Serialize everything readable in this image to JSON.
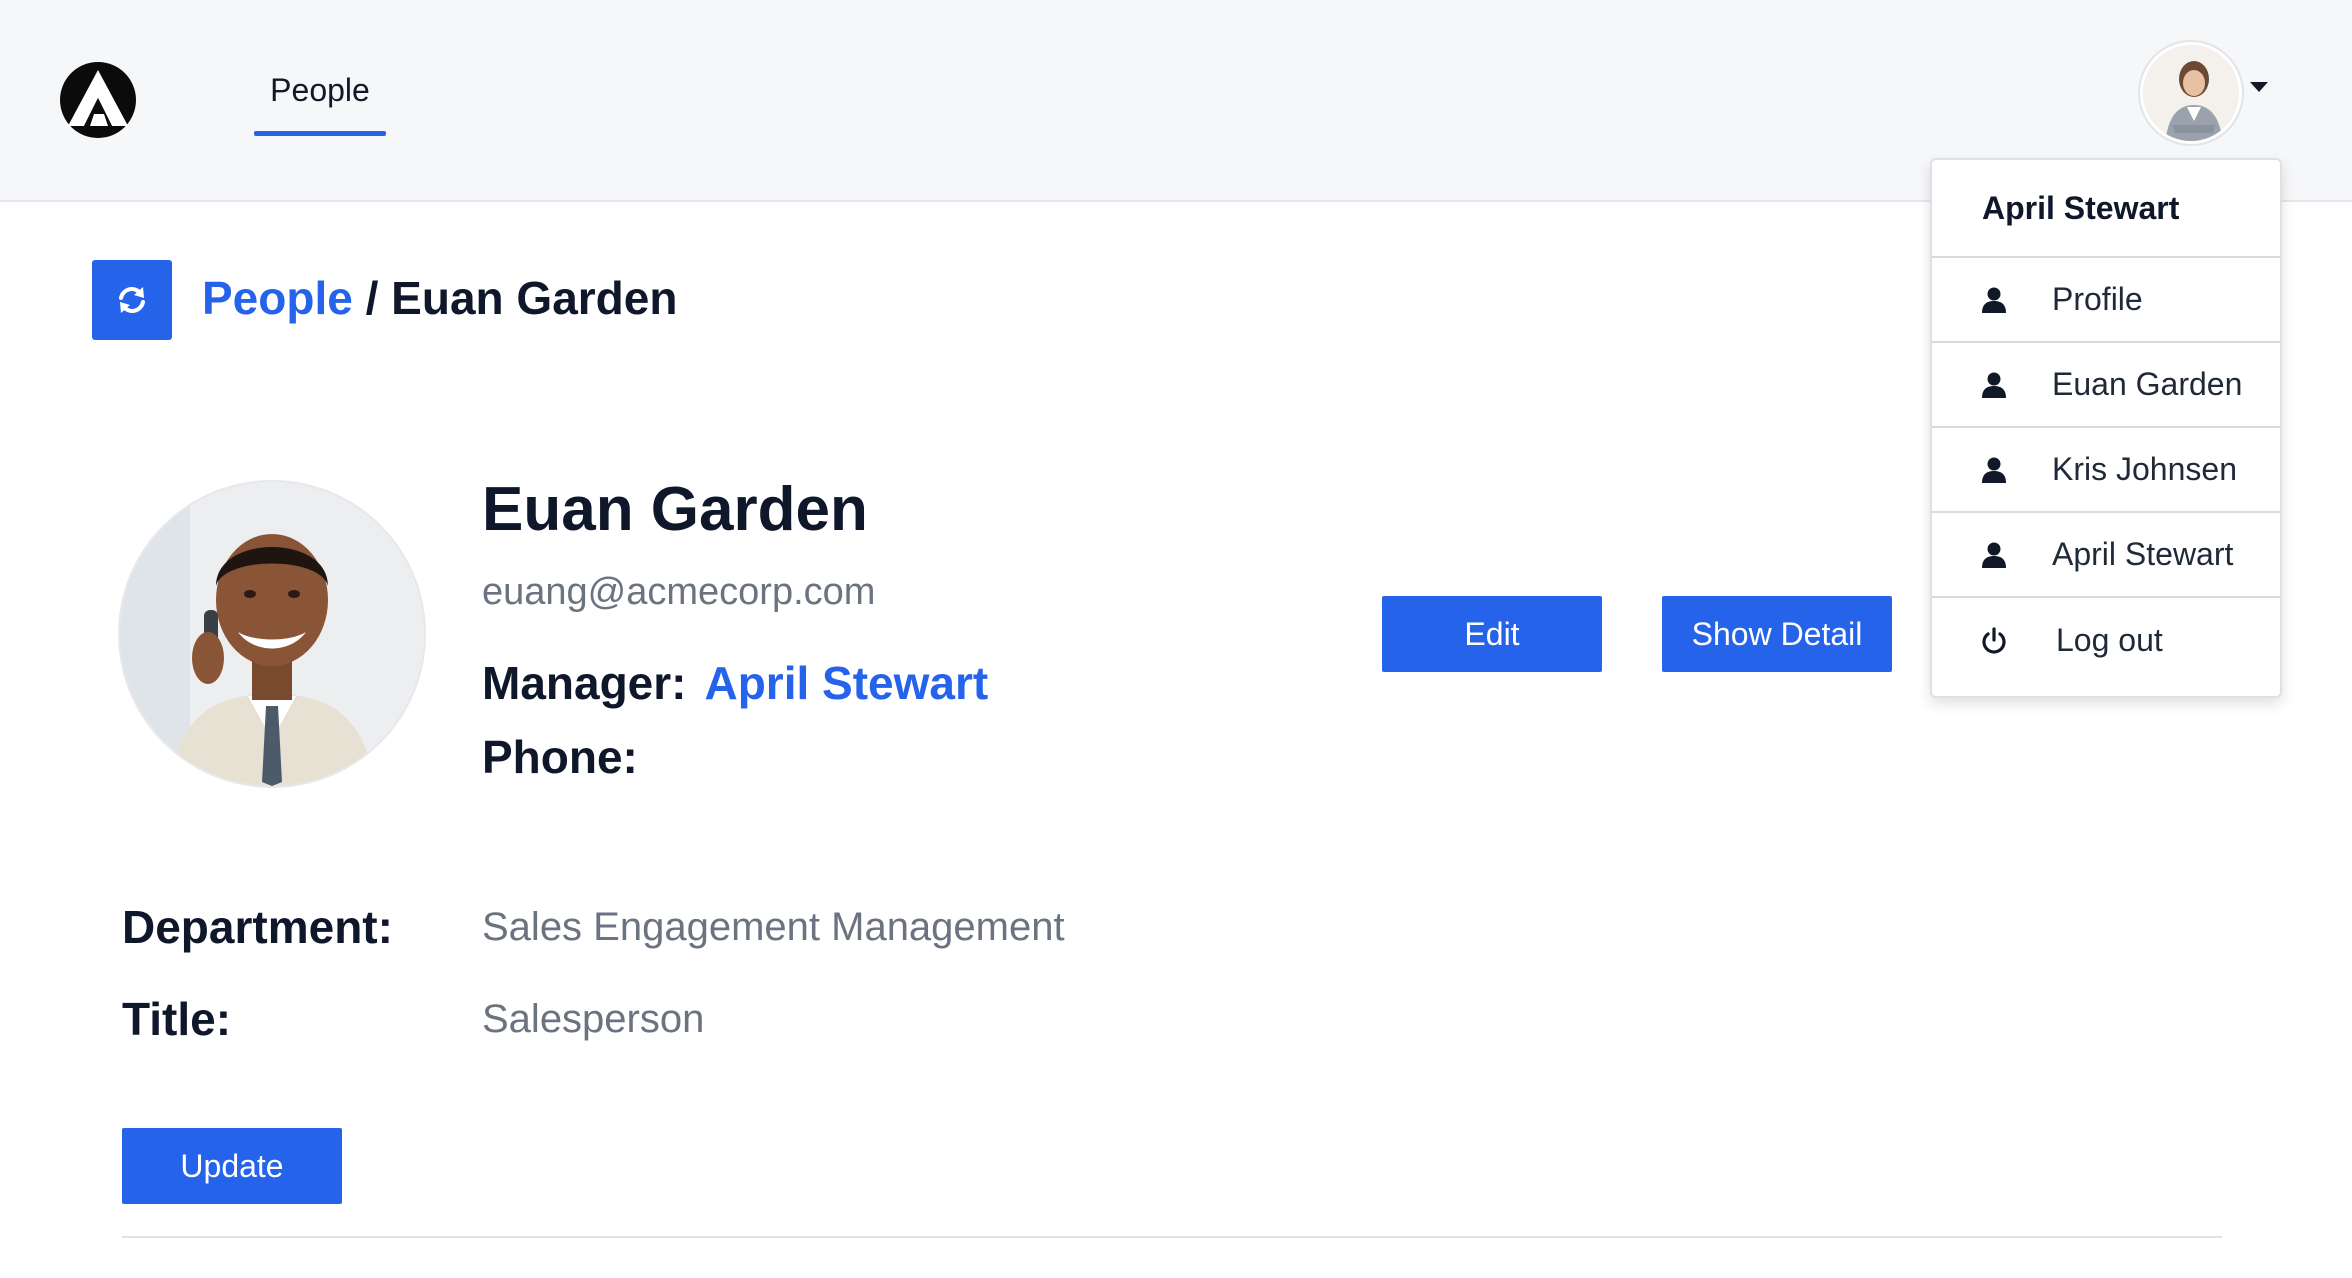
{
  "nav": {
    "logo_icon": "company-logo-icon",
    "tabs": [
      {
        "label": "People",
        "active": true
      }
    ],
    "accent_color": "#2563eb"
  },
  "user_menu": {
    "avatar_icon": "user-avatar",
    "caret_icon": "caret-down-icon",
    "header": "April Stewart",
    "items": [
      {
        "label": "Profile",
        "icon": "user-icon"
      },
      {
        "label": "Euan Garden",
        "icon": "user-icon"
      },
      {
        "label": "Kris Johnsen",
        "icon": "user-icon"
      },
      {
        "label": "April Stewart",
        "icon": "user-icon"
      },
      {
        "label": "Log out",
        "icon": "power-icon"
      }
    ]
  },
  "breadcrumb": {
    "refresh_icon": "refresh-icon",
    "parent": "People",
    "separator": " / ",
    "current": "Euan Garden"
  },
  "person": {
    "name": "Euan Garden",
    "email": "euang@acmecorp.com",
    "manager_label": "Manager:",
    "manager_value": "April Stewart",
    "phone_label": "Phone:",
    "phone_value": "",
    "department_label": "Department:",
    "department_value": "Sales Engagement Management",
    "title_label": "Title:",
    "title_value": "Salesperson"
  },
  "actions": {
    "edit": "Edit",
    "show_detail": "Show Detail",
    "update": "Update"
  }
}
